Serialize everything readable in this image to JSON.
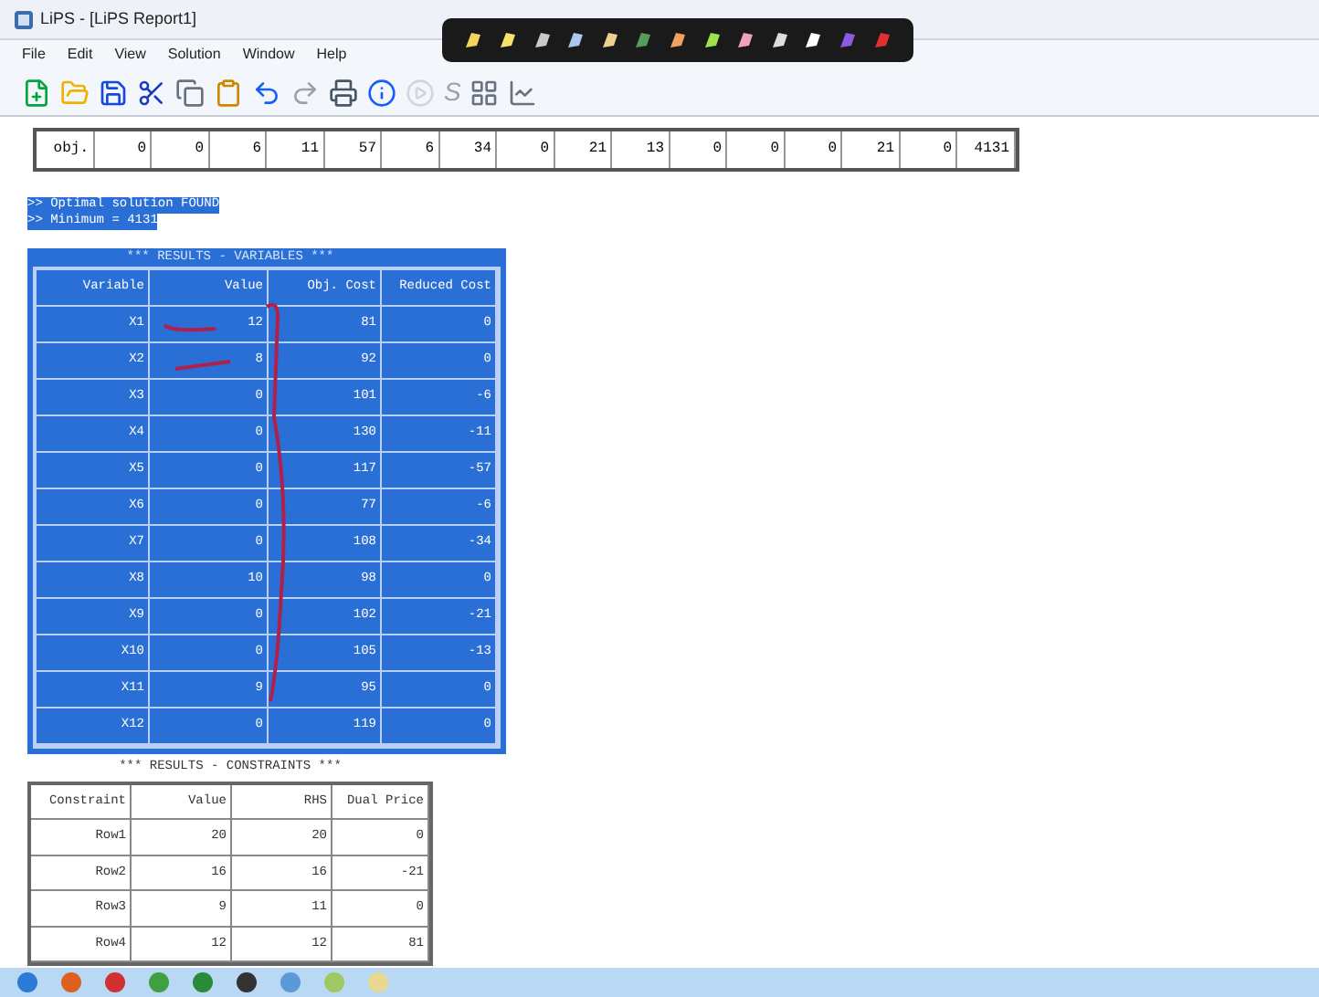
{
  "window": {
    "title": "LiPS - [LiPS Report1]"
  },
  "menu": [
    "File",
    "Edit",
    "View",
    "Solution",
    "Window",
    "Help"
  ],
  "toolbar": {
    "s_button": "S"
  },
  "objective_row": [
    "obj.",
    "0",
    "0",
    "6",
    "11",
    "57",
    "6",
    "34",
    "0",
    "21",
    "13",
    "0",
    "0",
    "0",
    "21",
    "0",
    "4131"
  ],
  "messages": [
    ">> Optimal solution FOUND",
    ">> Minimum = 4131"
  ],
  "variables": {
    "title": "*** RESULTS - VARIABLES ***",
    "columns": [
      "Variable",
      "Value",
      "Obj. Cost",
      "Reduced Cost"
    ],
    "rows": [
      [
        "X1",
        "12",
        "81",
        "0"
      ],
      [
        "X2",
        "8",
        "92",
        "0"
      ],
      [
        "X3",
        "0",
        "101",
        "-6"
      ],
      [
        "X4",
        "0",
        "130",
        "-11"
      ],
      [
        "X5",
        "0",
        "117",
        "-57"
      ],
      [
        "X6",
        "0",
        "77",
        "-6"
      ],
      [
        "X7",
        "0",
        "108",
        "-34"
      ],
      [
        "X8",
        "10",
        "98",
        "0"
      ],
      [
        "X9",
        "0",
        "102",
        "-21"
      ],
      [
        "X10",
        "0",
        "105",
        "-13"
      ],
      [
        "X11",
        "9",
        "95",
        "0"
      ],
      [
        "X12",
        "0",
        "119",
        "0"
      ]
    ]
  },
  "constraints": {
    "title": "*** RESULTS - CONSTRAINTS ***",
    "columns": [
      "Constraint",
      "Value",
      "RHS",
      "Dual Price"
    ],
    "rows": [
      [
        "Row1",
        "20",
        "20",
        "0"
      ],
      [
        "Row2",
        "16",
        "16",
        "-21"
      ],
      [
        "Row3",
        "9",
        "11",
        "0"
      ],
      [
        "Row4",
        "12",
        "12",
        "81"
      ]
    ]
  }
}
